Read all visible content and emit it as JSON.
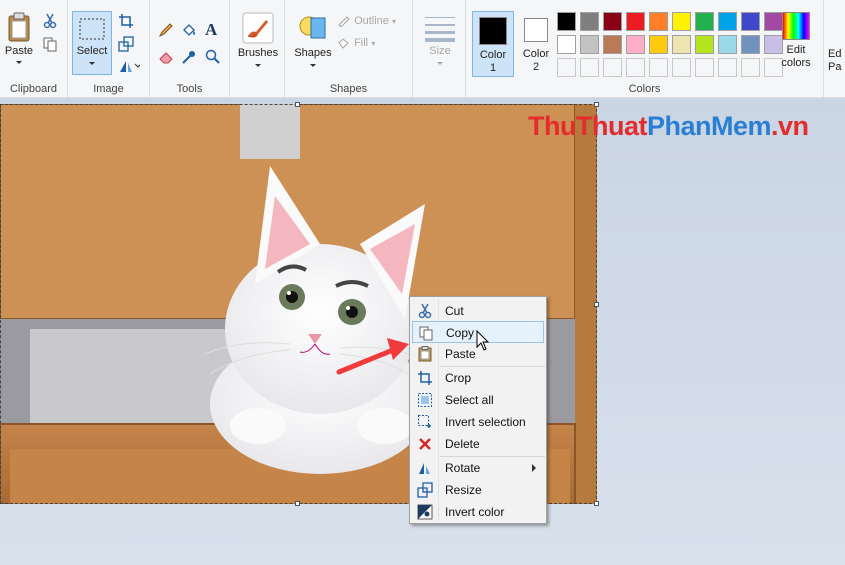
{
  "ribbon": {
    "clipboard": {
      "group_label": "Clipboard",
      "paste_label": "Paste"
    },
    "image": {
      "group_label": "Image",
      "select_label": "Select"
    },
    "tools": {
      "group_label": "Tools"
    },
    "brushes": {
      "label": "Brushes"
    },
    "shapes": {
      "group_label": "Shapes",
      "shapes_label": "Shapes",
      "outline_label": "Outline",
      "fill_label": "Fill"
    },
    "size": {
      "label": "Size"
    },
    "colors": {
      "group_label": "Colors",
      "color1_label": "Color",
      "color1_num": "1",
      "color2_label": "Color",
      "color2_num": "2",
      "edit_label_1": "Edit",
      "edit_label_2": "colors",
      "edit_paint3d_1": "Ed",
      "edit_paint3d_2": "Pa",
      "color1_value": "#000000",
      "color2_value": "#ffffff",
      "palette_row1": [
        "#000000",
        "#7f7f7f",
        "#880015",
        "#ed1c24",
        "#ff7f27",
        "#fff200",
        "#22b14c",
        "#00a2e8",
        "#3f48cc",
        "#a349a4"
      ],
      "palette_row2": [
        "#ffffff",
        "#c3c3c3",
        "#b97a57",
        "#ffaec9",
        "#ffc90e",
        "#efe4b0",
        "#b5e61d",
        "#99d9ea",
        "#7092be",
        "#c8bfe7"
      ]
    }
  },
  "watermark": {
    "part1": "Thu",
    "part2": "Thuat",
    "part3": "PhanMem",
    "part4": ".vn",
    "color_a": "#e52b2b",
    "color_b": "#2a7fd4"
  },
  "context_menu": {
    "items": [
      {
        "label": "Cut",
        "icon": "scissors-icon"
      },
      {
        "label": "Copy",
        "icon": "copy-icon"
      },
      {
        "label": "Paste",
        "icon": "paste-icon"
      },
      {
        "label": "Crop",
        "icon": "crop-icon"
      },
      {
        "label": "Select all",
        "icon": "select-all-icon"
      },
      {
        "label": "Invert selection",
        "icon": "invert-selection-icon"
      },
      {
        "label": "Delete",
        "icon": "delete-icon"
      },
      {
        "label": "Rotate",
        "icon": "rotate-icon"
      },
      {
        "label": "Resize",
        "icon": "resize-icon"
      },
      {
        "label": "Invert color",
        "icon": "invert-color-icon"
      }
    ]
  }
}
